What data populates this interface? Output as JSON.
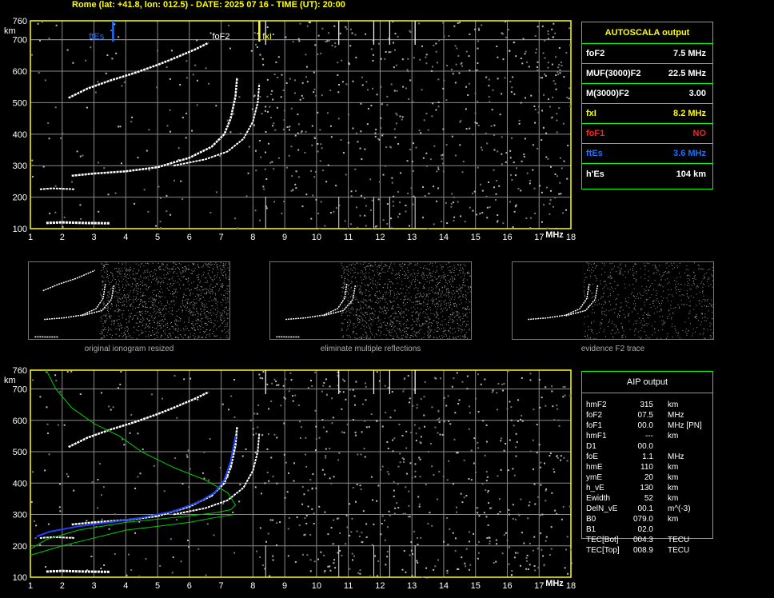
{
  "header": {
    "title": "Rome (lat: +41.8, lon: 012.5) - DATE: 2025 07 16 - TIME (UT): 20:00"
  },
  "colors": {
    "grid": "#8a8a8a",
    "axis": "#ffff00",
    "fxl": "#ffff00",
    "ftes": "#1f6fff",
    "foF1": "#ff2020",
    "panel_border": "#00ff00",
    "trace": "#ffffff",
    "profile_green": "#00cc00",
    "profile_blue": "#2040ff"
  },
  "ionogram": {
    "x_ticks": [
      "1",
      "2",
      "3",
      "4",
      "5",
      "6",
      "7",
      "8",
      "9",
      "10",
      "11",
      "12",
      "13",
      "14",
      "15",
      "16",
      "17",
      "18"
    ],
    "y_ticks": [
      "100",
      "200",
      "300",
      "400",
      "500",
      "600",
      "700",
      "760"
    ],
    "y_unit": "km",
    "x_unit": "MHz",
    "x_range": [
      1,
      18
    ],
    "y_range": [
      100,
      760
    ],
    "markers": {
      "ftEs": {
        "label": "ftEs",
        "freq": 3.6
      },
      "foF2": {
        "label": "foF2",
        "freq": 7.5
      },
      "fxI": {
        "label": "fxI",
        "freq": 8.2
      }
    }
  },
  "autoscala": {
    "title": "AUTOSCALA output",
    "rows": [
      {
        "name": "foF2",
        "value": "7.5 MHz",
        "color": "#ffffff"
      },
      {
        "name": "MUF(3000)F2",
        "value": "22.5 MHz",
        "color": "#ffffff"
      },
      {
        "name": "M(3000)F2",
        "value": "3.00",
        "color": "#ffffff"
      },
      {
        "name": "fxI",
        "value": "8.2 MHz",
        "color": "#ffff00"
      },
      {
        "name": "foF1",
        "value": "NO",
        "color": "#ff2020"
      },
      {
        "name": "ftEs",
        "value": "3.6 MHz",
        "color": "#1f6fff"
      },
      {
        "name": "h'Es",
        "value": "104    km",
        "color": "#ffffff"
      }
    ]
  },
  "thumbnails": [
    {
      "caption": "original ionogram resized"
    },
    {
      "caption": "eliminate multiple reflections"
    },
    {
      "caption": "evidence F2 trace"
    }
  ],
  "aip": {
    "title": "AIP output",
    "rows": [
      {
        "name": "hmF2",
        "value": "315",
        "unit": "km"
      },
      {
        "name": "foF2",
        "value": "07.5",
        "unit": "MHz"
      },
      {
        "name": "foF1",
        "value": "00.0",
        "unit": "MHz    [PN]"
      },
      {
        "name": "hmF1",
        "value": "---",
        "unit": "km"
      },
      {
        "name": "D1",
        "value": "00.0",
        "unit": ""
      },
      {
        "name": "foE",
        "value": "1.1",
        "unit": "MHz"
      },
      {
        "name": "hmE",
        "value": "110",
        "unit": "km"
      },
      {
        "name": "ymE",
        "value": "20",
        "unit": "km"
      },
      {
        "name": "h_vE",
        "value": "130",
        "unit": "km"
      },
      {
        "name": "Ewidth",
        "value": "52",
        "unit": "km"
      },
      {
        "name": "DelN_vE",
        "value": "00.1",
        "unit": "m^(-3)"
      },
      {
        "name": "B0",
        "value": "079.0",
        "unit": "km"
      },
      {
        "name": "B1",
        "value": "02.0",
        "unit": ""
      },
      {
        "name": "TEC[Bot]",
        "value": "004.3",
        "unit": "TECU"
      },
      {
        "name": "TEC[Top]",
        "value": "008.9",
        "unit": "TECU"
      }
    ]
  }
}
